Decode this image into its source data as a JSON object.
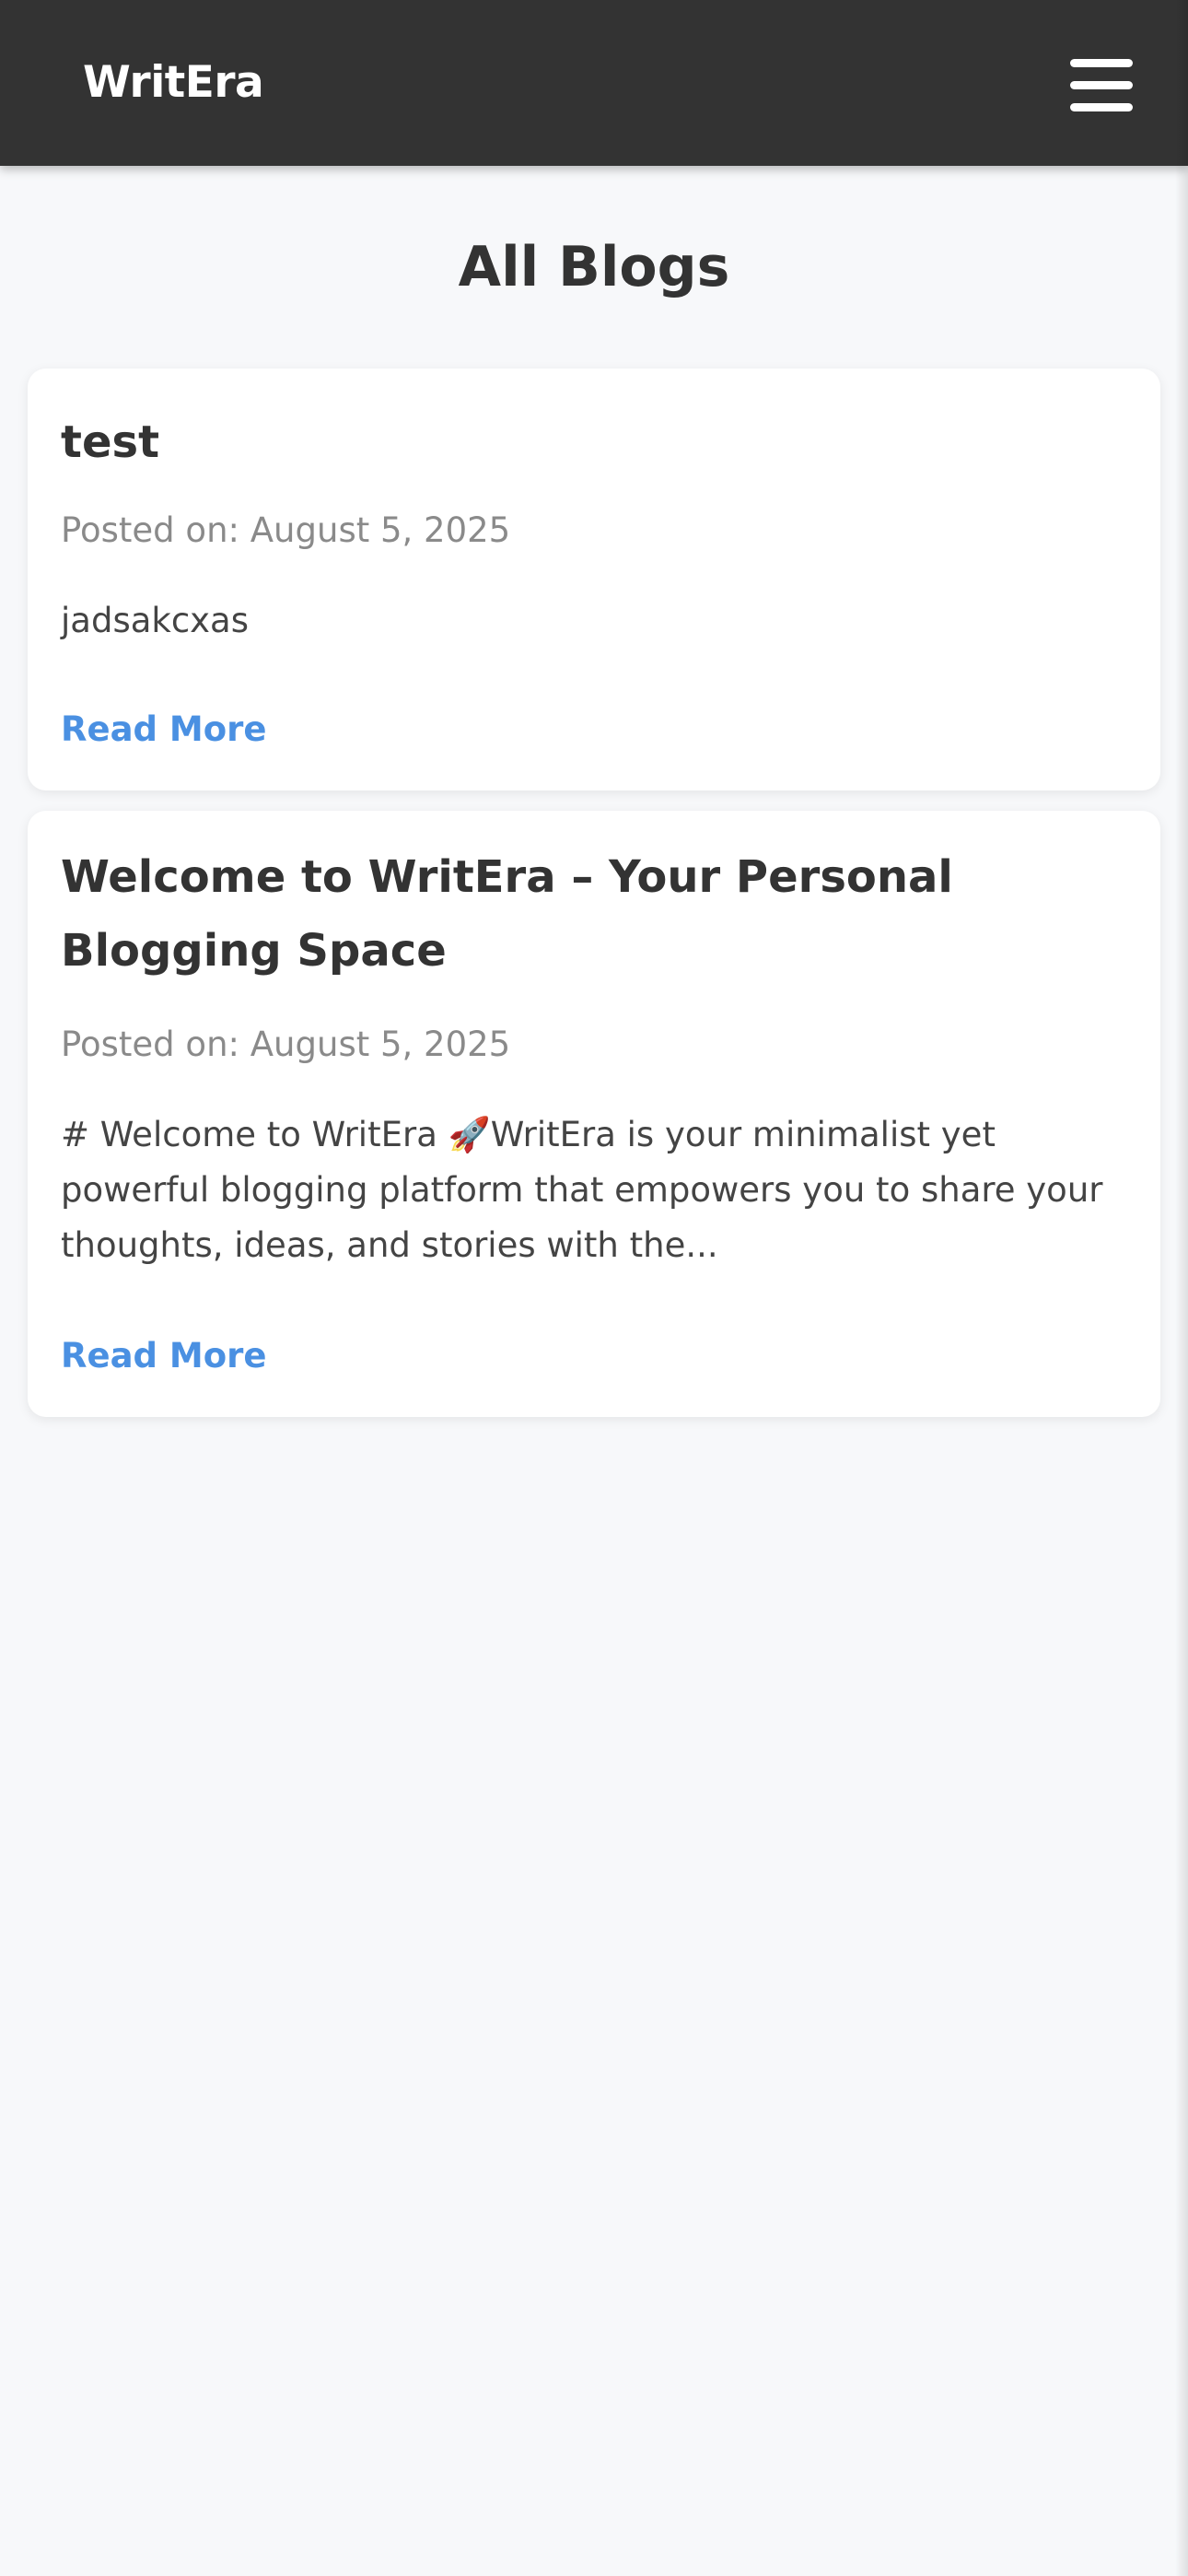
{
  "app": {
    "brand": "WritEra",
    "menu_icon": "hamburger-menu-icon"
  },
  "page": {
    "title": "All Blogs"
  },
  "posts": [
    {
      "title": "test",
      "meta": "Posted on: August 5, 2025",
      "excerpt": "jadsakcxas",
      "read_more": "Read More"
    },
    {
      "title": "Welcome to WritEra – Your Personal Blogging Space",
      "meta": "Posted on: August 5, 2025",
      "excerpt": "# Welcome to WritEra 🚀WritEra is your minimalist yet powerful blogging platform that empowers you to share your thoughts, ideas, and stories with the...",
      "read_more": "Read More"
    }
  ],
  "colors": {
    "navbar": "#333333",
    "background": "#f7f8fa",
    "link": "#4a90e2",
    "meta": "#8a8a8a"
  }
}
